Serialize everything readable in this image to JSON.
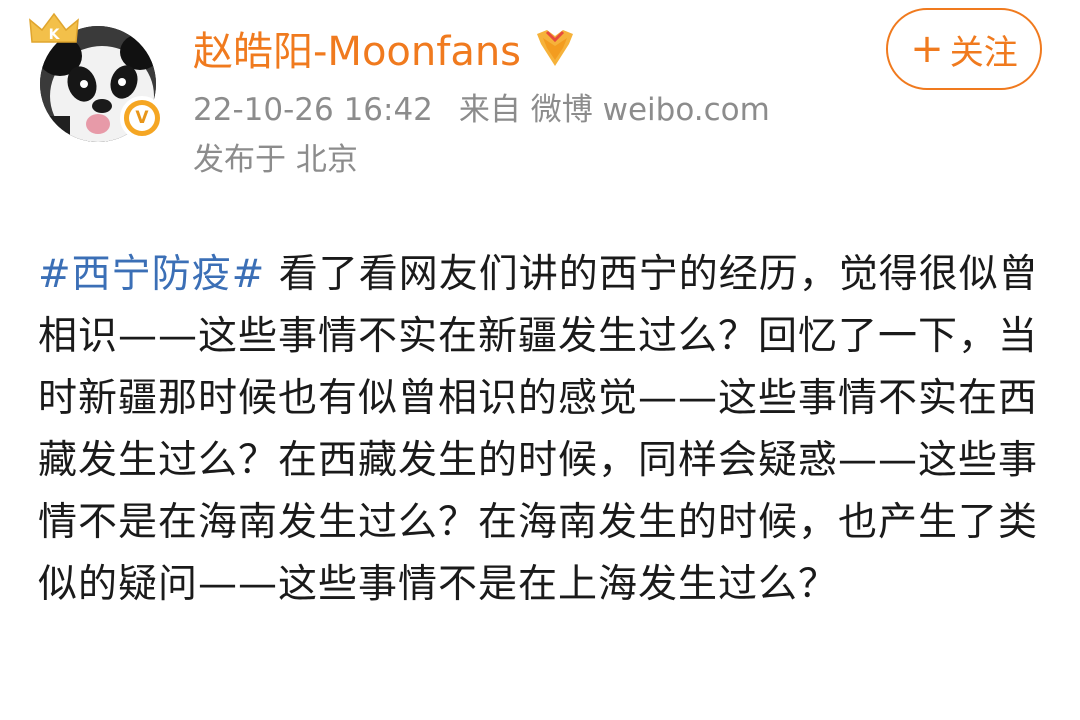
{
  "post": {
    "author": {
      "name": "赵皓阳-Moonfans",
      "avatar_icon": "panda-avatar",
      "crown_icon": "crown-badge-icon",
      "verified_icon": "verified-v-icon",
      "medal_icon": "medal-icon"
    },
    "meta": {
      "datetime": "22-10-26 16:42",
      "source_prefix": "来自",
      "source": "微博 weibo.com",
      "location": "发布于 北京"
    },
    "follow_button": {
      "plus": "+",
      "label": "关注"
    },
    "content": {
      "hashtag": "#西宁防疫#",
      "text": " 看了看网友们讲的西宁的经历，觉得很似曾相识——这些事情不实在新疆发生过么？回忆了一下，当时新疆那时候也有似曾相识的感觉——这些事情不实在西藏发生过么？在西藏发生的时候，同样会疑惑——这些事情不是在海南发生过么？在海南发生的时候，也产生了类似的疑问——这些事情不是在上海发生过么？"
    }
  },
  "colors": {
    "username": "#f07a1e",
    "meta": "#8c8c8c",
    "hashtag": "#3b6fb6",
    "text": "#1a1a1a",
    "follow": "#f07a1e",
    "verified": "#f5a623"
  }
}
